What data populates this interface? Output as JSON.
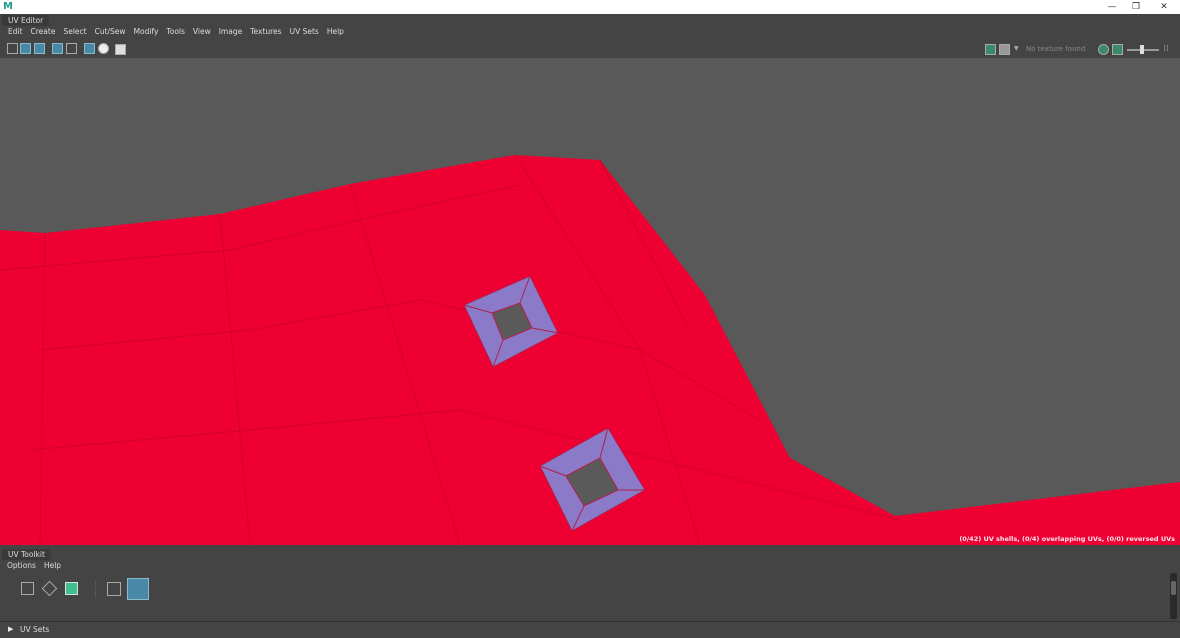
{
  "window": {
    "app_icon": "M",
    "minimize": "—",
    "restore": "❐",
    "close": "✕"
  },
  "uv_editor": {
    "title": "UV Editor",
    "menu": [
      "Edit",
      "Create",
      "Select",
      "Cut/Sew",
      "Modify",
      "Tools",
      "View",
      "Image",
      "Textures",
      "UV Sets",
      "Help"
    ],
    "texture_status": "No texture found",
    "status_text": "(0/42) UV shells, (0/4) overlapping UVs, (0/0) reversed UVs",
    "colors": {
      "mesh": "#ee0033",
      "selected_faces": "#8a7ac8",
      "background": "#595959"
    }
  },
  "uv_toolkit": {
    "title": "UV Toolkit",
    "menu": [
      "Options",
      "Help"
    ],
    "uv_sets_label": "UV Sets"
  }
}
